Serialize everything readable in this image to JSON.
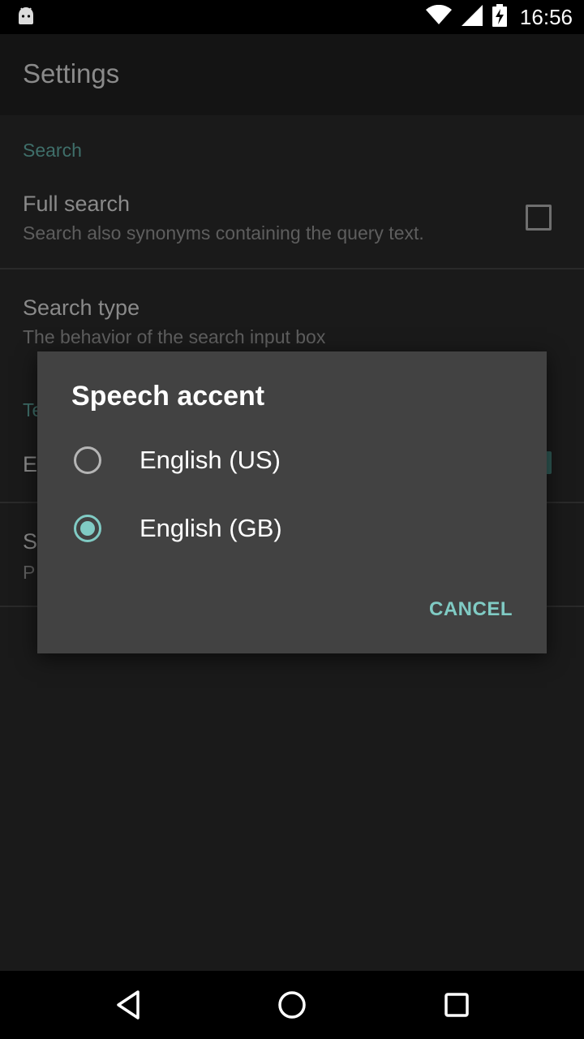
{
  "status_bar": {
    "time": "16:56",
    "icons": [
      "android-icon",
      "wifi-icon",
      "signal-icon",
      "battery-charging-icon"
    ]
  },
  "app_bar": {
    "title": "Settings"
  },
  "settings": {
    "section_search": "Search",
    "full_search": {
      "title": "Full search",
      "summary": "Search also synonyms containing the query text.",
      "checked": false
    },
    "search_type": {
      "title": "Search type",
      "summary": "The behavior of the search input box"
    },
    "section_partial": "Te",
    "row3_partial": "E",
    "row4_title_partial": "S",
    "row4_summary_partial": "P"
  },
  "dialog": {
    "title": "Speech accent",
    "options": [
      {
        "label": "English (US)",
        "selected": false
      },
      {
        "label": "English (GB)",
        "selected": true
      }
    ],
    "cancel_label": "CANCEL",
    "accent_color": "#80cbc4"
  },
  "nav_bar": {
    "icons": [
      "back-icon",
      "home-icon",
      "recents-icon"
    ]
  }
}
